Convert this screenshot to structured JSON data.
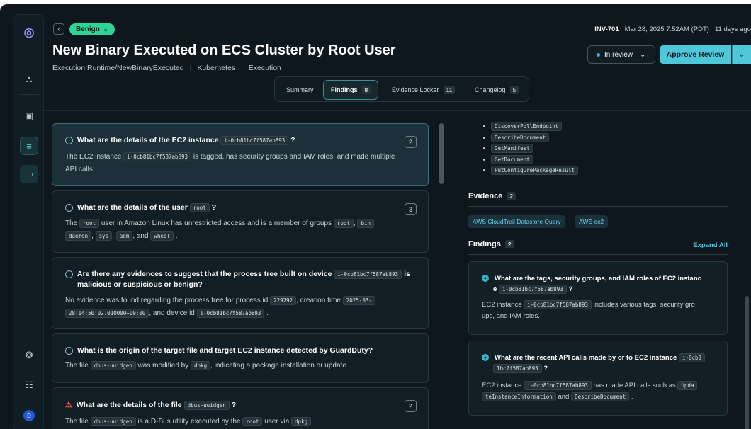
{
  "header": {
    "verdict": "Benign",
    "title": "New Binary Executed on ECS Cluster by Root User",
    "meta_items": [
      "Execution:Runtime/NewBinaryExecuted",
      "Kubernetes",
      "Execution"
    ],
    "investigation_id": "INV-701",
    "timestamp": "Mar 28, 2025 7:52AM (PDT)",
    "age": "11 days ago",
    "status": "In review",
    "approve_label": "Approve Review"
  },
  "tabs": [
    {
      "label": "Summary",
      "count": ""
    },
    {
      "label": "Findings",
      "count": "8"
    },
    {
      "label": "Evidence Locker",
      "count": "11"
    },
    {
      "label": "Changelog",
      "count": "5"
    }
  ],
  "questions": [
    {
      "q_pre": "What are the details of the EC2 instance",
      "q_code": "i-0cb81bc7f587ab893",
      "q_post": "?",
      "count": "2",
      "a_pre": "The EC2 instance",
      "a_code": "i-0cb81bc7f587ab893",
      "a_post": "is tagged, has security groups and IAM roles, and made multiple",
      "a_line2": "API calls."
    },
    {
      "q_pre": "What are the details of the user",
      "q_code": "root",
      "q_post": "?",
      "count": "3",
      "a_pre": "The",
      "a_code": "root",
      "a_post": "user in Amazon Linux has unrestricted access and is a member of groups",
      "groups": [
        "root",
        "bin",
        "daemon",
        "sys",
        "adm",
        "wheel"
      ],
      "a_and": ", and"
    },
    {
      "q_pre": "Are there any evidences to suggest that the process tree built on device",
      "q_code": "i-0cb81bc7f587ab893",
      "q_post": "is",
      "q_line2": "malicious or suspicious or benign?",
      "a_pre": "No evidence was found regarding the process tree for process id",
      "a_code": "229792",
      "a_mid": ", creation time",
      "a_code2": "2025-03-",
      "a_code3": "28T14:50:02.010000+00:00",
      "a_mid2": ", and device id",
      "a_code4": "i-0cb81bc7f587ab893"
    },
    {
      "q_pre": "What is the origin of the target file and target EC2 instance detected by GuardDuty?",
      "a_pre": "The file",
      "a_code": "dbus-uuidgen",
      "a_mid": "was modified by",
      "a_code2": "dpkg",
      "a_post": ", indicating a package installation or update."
    },
    {
      "q_pre": "What are the details of the file",
      "q_code": "dbus-uuidgen",
      "q_post": "?",
      "count": "2",
      "a_pre": "The file",
      "a_code": "dbus-uuidgen",
      "a_mid": "is a D-Bus utility executed by the",
      "a_code2": "root",
      "a_mid2": "user via",
      "a_code3": "dpkg"
    }
  ],
  "right": {
    "api_calls": [
      "DiscoverPollEndpoint",
      "DescribeDocument",
      "GetManifest",
      "GetDocument",
      "PutConfigurePackageResult"
    ],
    "evidence_label": "Evidence",
    "evidence_count": "2",
    "evidence_chips": [
      "AWS CloudTrail Datastore Query",
      "AWS ec2"
    ],
    "findings_label": "Findings",
    "findings_count": "2",
    "expand_all": "Expand All",
    "findings": [
      {
        "q_line1": "What are the tags, security groups, and IAM roles of EC2 instanc",
        "q_line2_pre": "e",
        "q_code": "i-0cb81bc7f587ab893",
        "q_post": "?",
        "a_pre": "EC2 instance",
        "a_code": "i-0cb81bc7f587ab893",
        "a_post": "includes various tags, security gro",
        "a_line2": "ups, and IAM roles."
      },
      {
        "q_line1": "What are the recent API calls made by or to EC2 instance",
        "q_code_a": "i-0cb8",
        "q_code_b": "1bc7f587ab893",
        "q_post": "?",
        "a_pre": "EC2 instance",
        "a_code": "i-0cb81bc7f587ab893",
        "a_post": "has made API calls such as",
        "a_code2": "Upda",
        "a_code3": "teInstanceInformation",
        "a_and": "and",
        "a_code4": "DescribeDocument"
      }
    ]
  }
}
